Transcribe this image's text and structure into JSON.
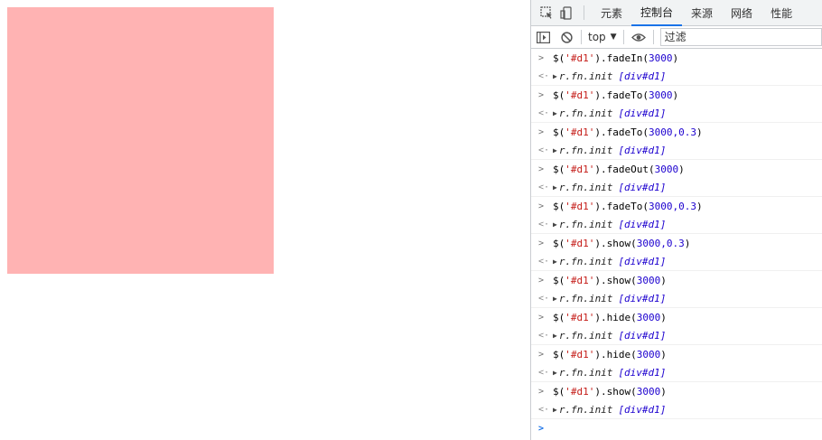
{
  "page": {
    "box_color": "#ffb3b3"
  },
  "devtools": {
    "tabs": [
      {
        "label": "元素",
        "active": false
      },
      {
        "label": "控制台",
        "active": true
      },
      {
        "label": "来源",
        "active": false
      },
      {
        "label": "网络",
        "active": false
      },
      {
        "label": "性能",
        "active": false
      }
    ],
    "toolbar": {
      "context": "top",
      "filter_placeholder": "过滤"
    },
    "console": {
      "entries": [
        {
          "method": "fadeIn",
          "args": "3000"
        },
        {
          "method": "fadeTo",
          "args": "3000"
        },
        {
          "method": "fadeTo",
          "args": "3000,0.3"
        },
        {
          "method": "fadeOut",
          "args": "3000"
        },
        {
          "method": "fadeTo",
          "args": "3000,0.3"
        },
        {
          "method": "show",
          "args": "3000,0.3"
        },
        {
          "method": "show",
          "args": "3000"
        },
        {
          "method": "hide",
          "args": "3000"
        },
        {
          "method": "hide",
          "args": "3000"
        },
        {
          "method": "show",
          "args": "3000"
        }
      ],
      "selector": "'#d1'",
      "result_label": "r.fn.init",
      "result_tag": "[div#d1]"
    }
  }
}
